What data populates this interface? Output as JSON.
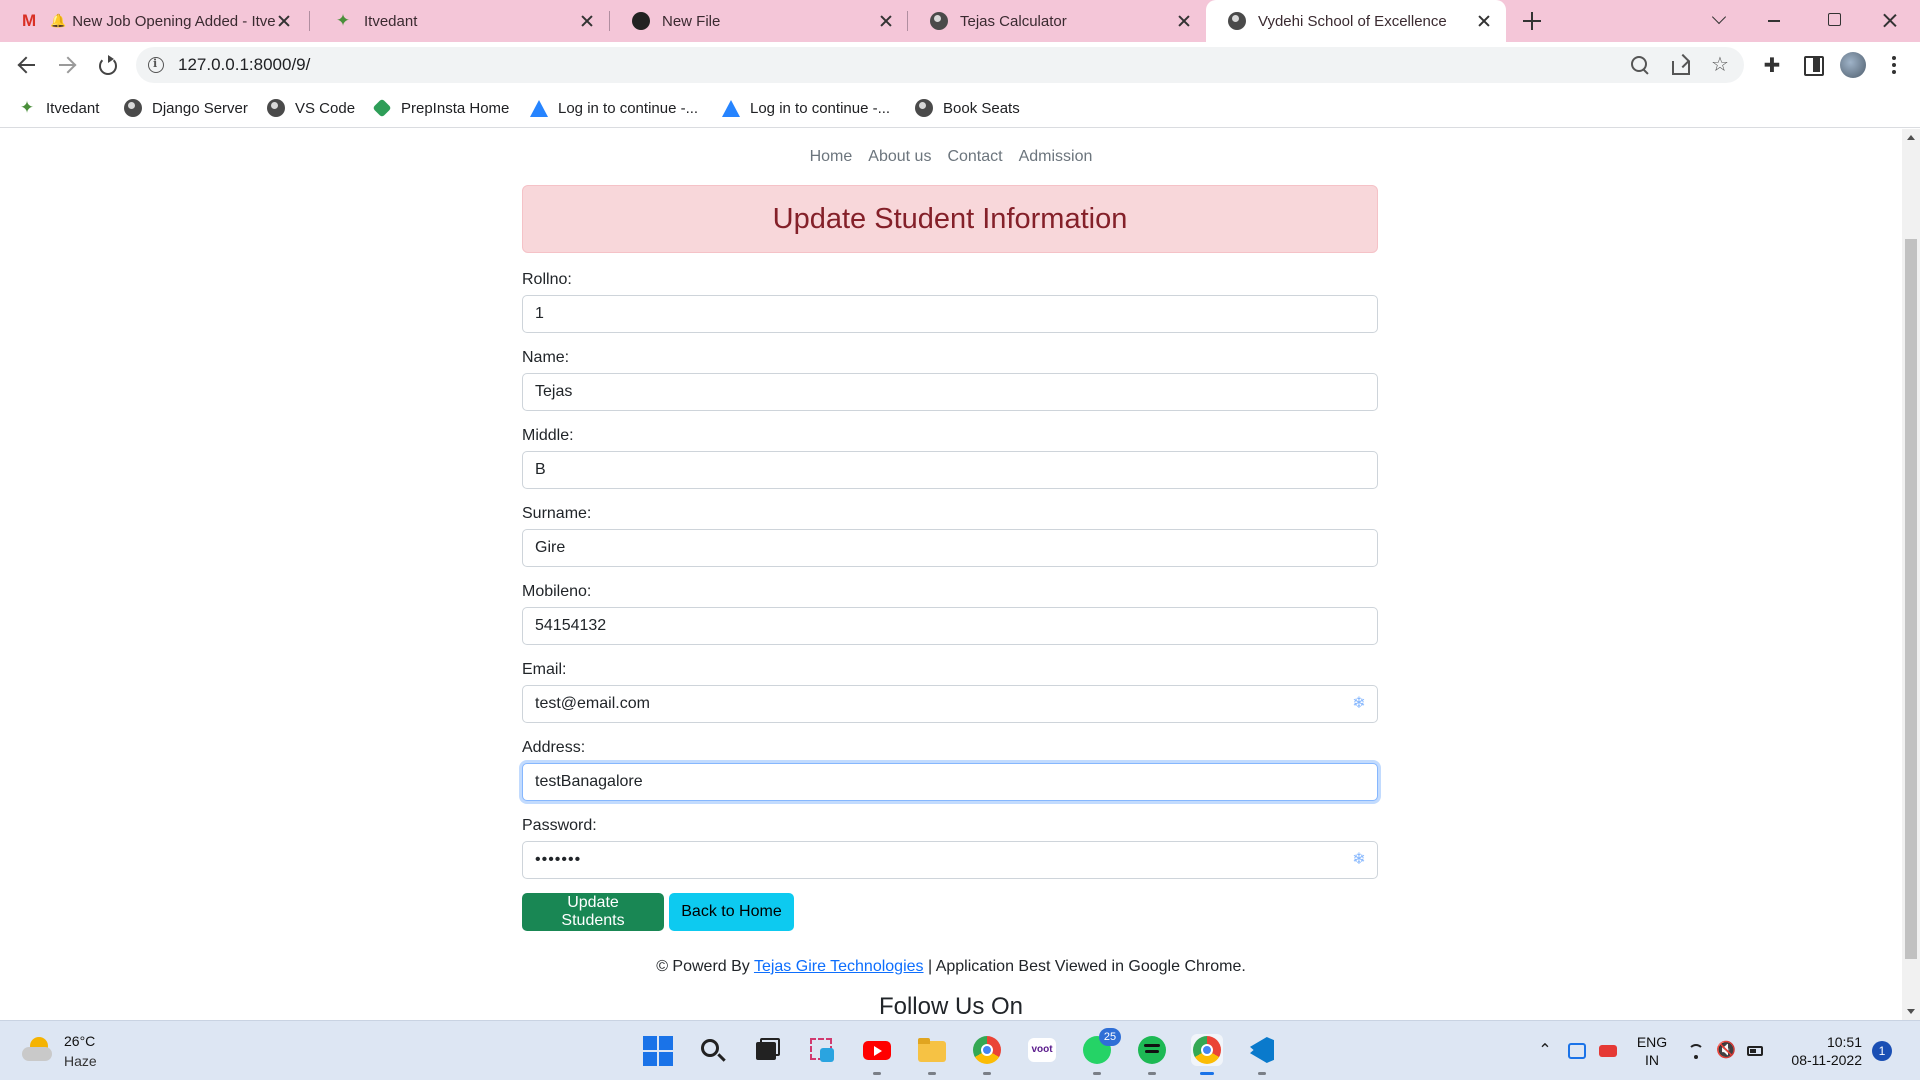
{
  "browser": {
    "tabs": [
      {
        "title": "New Job Opening Added - Itvedant",
        "icon": "gmail-icon",
        "active": false
      },
      {
        "title": "Itvedant",
        "icon": "butterfly-icon",
        "active": false
      },
      {
        "title": "New File",
        "icon": "github-icon",
        "active": false
      },
      {
        "title": "Tejas Calculator",
        "icon": "globe-icon",
        "active": false
      },
      {
        "title": "Vydehi School of Excellence",
        "icon": "globe-icon",
        "active": true
      }
    ],
    "url": "127.0.0.1:8000/9/",
    "bookmarks": [
      {
        "label": "Itvedant",
        "icon": "butterfly-icon"
      },
      {
        "label": "Django Server",
        "icon": "globe-icon"
      },
      {
        "label": "VS Code",
        "icon": "globe-icon"
      },
      {
        "label": "PrepInsta Home",
        "icon": "prepinsta-icon"
      },
      {
        "label": "Log in to continue -...",
        "icon": "atlassian-icon"
      },
      {
        "label": "Log in to continue -...",
        "icon": "atlassian-icon"
      },
      {
        "label": "Book Seats",
        "icon": "globe-icon"
      }
    ]
  },
  "page": {
    "nav": [
      "Home",
      "About us",
      "Contact",
      "Admission"
    ],
    "heading": "Update Student Information",
    "fields": [
      {
        "label": "Rollno:",
        "value": "1"
      },
      {
        "label": "Name:",
        "value": "Tejas"
      },
      {
        "label": "Middle:",
        "value": "B"
      },
      {
        "label": "Surname:",
        "value": "Gire"
      },
      {
        "label": "Mobileno:",
        "value": "54154132"
      },
      {
        "label": "Email:",
        "value": "test@email.com"
      },
      {
        "label": "Address:",
        "value": "testBanagalore"
      },
      {
        "label": "Password:",
        "value": "•••••••"
      }
    ],
    "buttons": {
      "update": "Update Students",
      "back": "Back to Home"
    },
    "footer": {
      "prefix": "© Powerd By ",
      "link": "Tejas Gire Technologies",
      "suffix": " | Application Best Viewed in Google Chrome."
    },
    "follow": "Follow Us On"
  },
  "taskbar": {
    "weather_temp": "26°C",
    "weather_desc": "Haze",
    "whatsapp_badge": "25",
    "lang_top": "ENG",
    "lang_bottom": "IN",
    "time": "10:51",
    "date": "08-11-2022",
    "notifications": "1"
  },
  "colors": {
    "tab_strip": "#f4c6d8",
    "alert_bg": "#f8d7da",
    "alert_text": "#842029",
    "btn_success": "#198754",
    "btn_info": "#0dcaf0",
    "link": "#0d6efd"
  }
}
